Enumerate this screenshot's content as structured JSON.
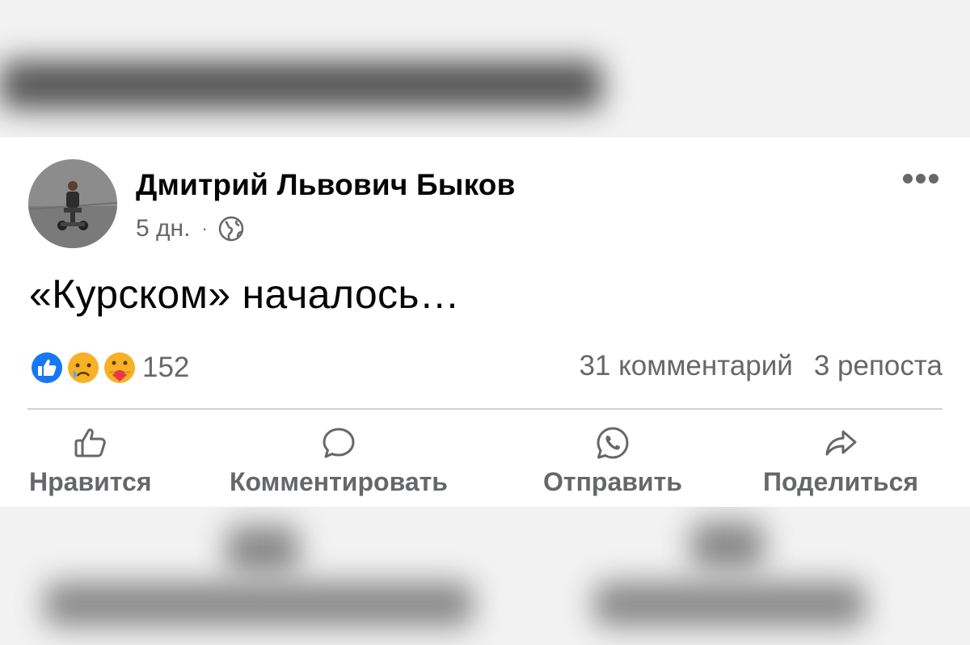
{
  "post": {
    "author": "Дмитрий Львович Быков",
    "time": "5 дн.",
    "separator": "·",
    "visibility_icon": "globe-icon",
    "text": "«Курском» началось…",
    "more_icon": "ellipsis-icon"
  },
  "reactions": {
    "icons": [
      "like-icon",
      "sad-icon",
      "care-icon"
    ],
    "count": "152",
    "comments": "31 комментарий",
    "shares": "3 репоста"
  },
  "actions": [
    {
      "label": "Нравится",
      "icon": "thumbs-up-icon"
    },
    {
      "label": "Комментировать",
      "icon": "comment-icon"
    },
    {
      "label": "Отправить",
      "icon": "whatsapp-icon"
    },
    {
      "label": "Поделиться",
      "icon": "share-arrow-icon"
    }
  ],
  "colors": {
    "like_blue": "#1877f2",
    "secondary_text": "#65676b",
    "divider": "#ced0d4"
  }
}
